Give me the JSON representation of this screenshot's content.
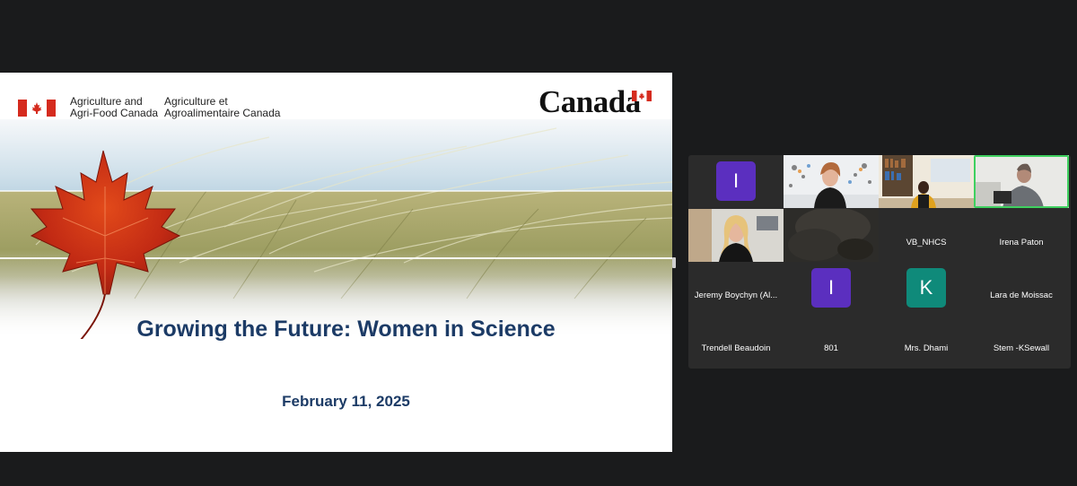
{
  "slide": {
    "department_en": [
      "Agriculture and",
      "Agri-Food Canada"
    ],
    "department_fr": [
      "Agriculture et",
      "Agroalimentaire Canada"
    ],
    "wordmark": "Canada",
    "title": "Growing the Future: Women in Science",
    "date": "February 11, 2025",
    "colors": {
      "title": "#1c3b66",
      "flag_red": "#d52b1e"
    }
  },
  "participants": [
    {
      "name": "",
      "initial": "I",
      "avatar_color": "#5b2fbf",
      "type": "avatar"
    },
    {
      "name": "",
      "type": "video",
      "video": "woman-in-black-art-background"
    },
    {
      "name": "",
      "type": "video",
      "video": "man-with-bookshelf"
    },
    {
      "name": "",
      "type": "video",
      "video": "man-at-desk",
      "active_speaker": true
    },
    {
      "name": "",
      "type": "video",
      "video": "woman-blonde-office"
    },
    {
      "name": "",
      "type": "video",
      "video": "dark-blurred-camera"
    },
    {
      "name": "VB_NHCS",
      "type": "name-only"
    },
    {
      "name": "Irena Paton",
      "type": "name-only"
    },
    {
      "name": "Jeremy Boychyn (Al...",
      "type": "name-only"
    },
    {
      "name": "",
      "initial": "I",
      "avatar_color": "#5b2fbf",
      "type": "avatar"
    },
    {
      "name": "",
      "initial": "K",
      "avatar_color": "#0f8a7a",
      "type": "avatar"
    },
    {
      "name": "Lara de Moissac",
      "type": "name-only"
    },
    {
      "name": "Trendell Beaudoin",
      "type": "name-only"
    },
    {
      "name": "801",
      "type": "name-only"
    },
    {
      "name": "Mrs. Dhami",
      "type": "name-only"
    },
    {
      "name": "Stem -KSewall",
      "type": "name-only"
    }
  ]
}
